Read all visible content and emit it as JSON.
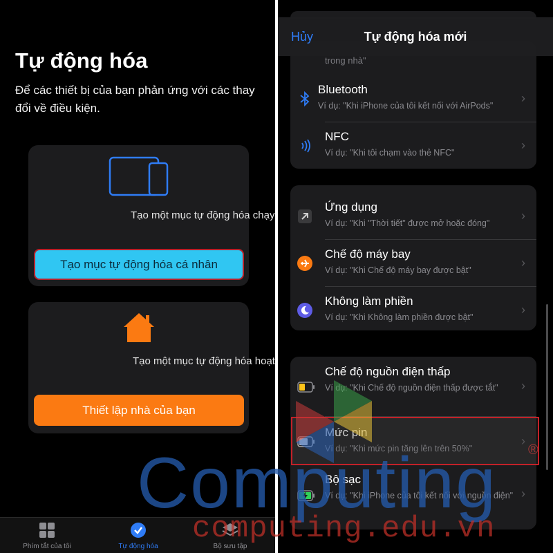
{
  "left": {
    "title": "Tự động hóa",
    "subtitle": "Để các thiết bị của bạn phản ứng với các thay đổi về điều kiện.",
    "personal_card": {
      "text": "Tạo một mục tự động hóa chạy trên iPhone hoặc iPad cá nhân.",
      "button": "Tạo mục tự động hóa cá nhân"
    },
    "home_card": {
      "text": "Tạo một mục tự động hóa hoạt động cho mọi người trong nhà.",
      "button": "Thiết lập nhà của bạn"
    },
    "tabs": [
      {
        "label": "Phím tắt của tôi",
        "icon": "grid-icon"
      },
      {
        "label": "Tự động hóa",
        "icon": "clock-check-icon"
      },
      {
        "label": "Bộ sưu tập",
        "icon": "layers-icon"
      }
    ]
  },
  "right": {
    "nav": {
      "cancel": "Hủy",
      "title": "Tự động hóa mới"
    },
    "partial_text": "trong nhà\"",
    "rows": [
      {
        "title": "Bluetooth",
        "desc": "Ví dụ: \"Khi iPhone của tôi kết nối với AirPods\"",
        "icon": "bluetooth-icon"
      },
      {
        "title": "NFC",
        "desc": "Ví dụ: \"Khi tôi chạm vào thẻ NFC\"",
        "icon": "nfc-icon"
      },
      {
        "title": "Ứng dụng",
        "desc": "Ví dụ: \"Khi \"Thời tiết\" được mở hoặc đóng\"",
        "icon": "app-arrow-icon"
      },
      {
        "title": "Chế độ máy bay",
        "desc": "Ví dụ: \"Khi Chế độ máy bay được bật\"",
        "icon": "airplane-icon"
      },
      {
        "title": "Không làm phiền",
        "desc": "Ví dụ: \"Khi Không làm phiền được bật\"",
        "icon": "moon-icon"
      },
      {
        "title": "Chế độ nguồn điện thấp",
        "desc": "Ví dụ: \"Khi Chế độ nguồn điện thấp được tắt\"",
        "icon": "low-power-battery-icon"
      },
      {
        "title": "Mức pin",
        "desc": "Ví dụ: \"Khi mức pin tăng lên trên 50%\"",
        "icon": "battery-icon"
      },
      {
        "title": "Bộ sạc",
        "desc": "Ví dụ: \"Khi iPhone của tôi kết nối với nguồn điện\"",
        "icon": "charging-battery-icon"
      }
    ]
  },
  "watermark": {
    "brand": "Computing",
    "registered": "®",
    "site": "computing.edu.vn"
  },
  "colors": {
    "accent_blue": "#2f7cf6",
    "personal_button": "#30c6f2",
    "home_button": "#fb7a12",
    "highlight_border": "#c32128"
  }
}
